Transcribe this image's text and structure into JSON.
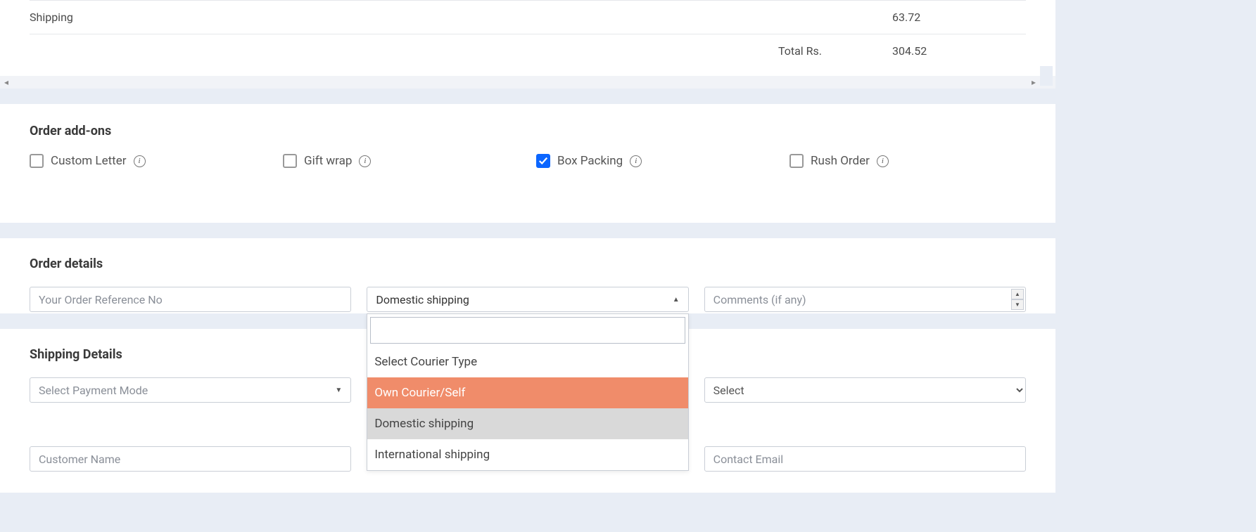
{
  "summary": {
    "shipping_label": "Shipping",
    "shipping_value": "63.72",
    "total_label": "Total Rs.",
    "total_value": "304.52"
  },
  "addons": {
    "title": "Order add-ons",
    "items": [
      {
        "label": "Custom Letter",
        "checked": false
      },
      {
        "label": "Gift wrap",
        "checked": false
      },
      {
        "label": "Box Packing",
        "checked": true
      },
      {
        "label": "Rush Order",
        "checked": false
      }
    ]
  },
  "order_details": {
    "title": "Order details",
    "reference_placeholder": "Your Order Reference No",
    "courier_selected": "Domestic shipping",
    "courier_dropdown": {
      "search_value": "",
      "options": [
        {
          "label": "Select Courier Type",
          "state": ""
        },
        {
          "label": "Own Courier/Self",
          "state": "highlight"
        },
        {
          "label": "Domestic shipping",
          "state": "selected"
        },
        {
          "label": "International shipping",
          "state": ""
        }
      ]
    },
    "comments_placeholder": "Comments (if any)"
  },
  "shipping_details": {
    "title": "Shipping Details",
    "payment_mode_placeholder": "Select Payment Mode",
    "right_select_placeholder": "Select",
    "customer_name_placeholder": "Customer Name",
    "contact_email_placeholder": "Contact Email"
  }
}
